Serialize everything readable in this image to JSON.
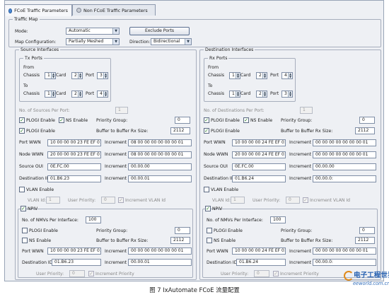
{
  "tabs": {
    "active": "FCoE Traffic Parameters",
    "inactive": "Non FCoE Traffic Parameters"
  },
  "traffic_map": {
    "title": "Traffic Map",
    "mode_label": "Mode:",
    "mode_value": "Automatic",
    "exclude_ports": "Exclude Ports",
    "map_config_label": "Map Configuration:",
    "map_config_value": "Partially Meshed",
    "direction_label": "Direction:",
    "direction_value": "Bidirectional"
  },
  "labels": {
    "chassis": "Chassis",
    "card": "Card",
    "port": "Port",
    "from": "From",
    "to": "To",
    "fcoe_enable": "PLOGI Enable",
    "ns_enable": "NS Enable",
    "priority_group": "Priority Group:",
    "plogi_enable": "PLOGI Enable",
    "buffer": "Buffer to Buffer Rx Size:",
    "port_wwn": "Port WWN",
    "node_wwn": "Node WWN",
    "increment": "Increment",
    "source_oui": "Source OUI",
    "destination_id": "Destination ID",
    "vlan_enable": "VLAN Enable",
    "vlan_id": "VLAN Id:",
    "user_priority": "User Priority:",
    "increment_vlan": "Increment VLAN Id",
    "npiv": "NPIV",
    "num_npiv": "No. of NMVs Per Interface:",
    "inc_priority": "Increment Priority"
  },
  "source": {
    "title": "Source Interfaces",
    "ports_title": "Tx Ports",
    "from": [
      "1",
      "2",
      "3"
    ],
    "to": [
      "1",
      "2",
      "4"
    ],
    "count_label": "No. of Sources Per Port:",
    "count": "1",
    "priority": "0",
    "buffer": "2112",
    "port_wwn": "10 00 00 00 23 FE EF 01",
    "port_wwn_inc": "08 00 00 00 00 00 00 01",
    "node_wwn": "20 00 00 00 23 FE EF 01",
    "node_wwn_inc": "08 00 00 00 00 00 00 01",
    "oui": "0E.FC.00",
    "oui_inc": "00.00.00",
    "dest_id": "01.B6.23",
    "dest_inc": "00.00.01",
    "vlan_id": "1",
    "user_priority": "0",
    "npiv_count": "100",
    "npiv_priority": "0",
    "npiv_buffer": "2112",
    "npiv_port_wwn": "10 00 00 00 23 FE EF 01",
    "npiv_port_wwn_inc": "00 00 00 00 00 00 00 01",
    "npiv_dest_id": "01.B6.23",
    "npiv_dest_inc": "00.00.01",
    "npiv_user_priority": "0"
  },
  "dest": {
    "title": "Destination Interfaces",
    "ports_title": "Rx Ports",
    "from": [
      "1",
      "2",
      "4"
    ],
    "to": [
      "1",
      "2",
      "3"
    ],
    "count_label": "No. of Destinations Per Port:",
    "count": "1",
    "priority": "0",
    "buffer": "2112",
    "port_wwn": "10 00 00 00 24 FE EF 01",
    "port_wwn_inc": "00 00 00 00 00 00 00 01",
    "node_wwn": "20 00 00 00 24 FE EF 01",
    "node_wwn_inc": "00 00 00 00 00 00 00 01",
    "oui": "0E.FC.00",
    "oui_inc": "00.00.00",
    "dest_id": "01.B6.24",
    "dest_inc": "00.00.0:",
    "vlan_id": "1",
    "user_priority": "0",
    "npiv_count": "100",
    "npiv_priority": "0",
    "npiv_buffer": "2112",
    "npiv_port_wwn": "10 00 00 00 24 FE EF 01",
    "npiv_port_wwn_inc": "00 00 00 00 00 00 00 01",
    "npiv_dest_id": "01.B6.24",
    "npiv_dest_inc": "00.00.0:",
    "npiv_user_priority": "0"
  },
  "caption": "图 7 IxAutomate FCoE 流量配置",
  "watermark": {
    "big": "电子工程世界",
    "small": "eeworld.com.cn"
  },
  "colors": {
    "tab_icon": "#4a8ad8",
    "check": "#1e7a1e",
    "logo": "#245fb0"
  }
}
